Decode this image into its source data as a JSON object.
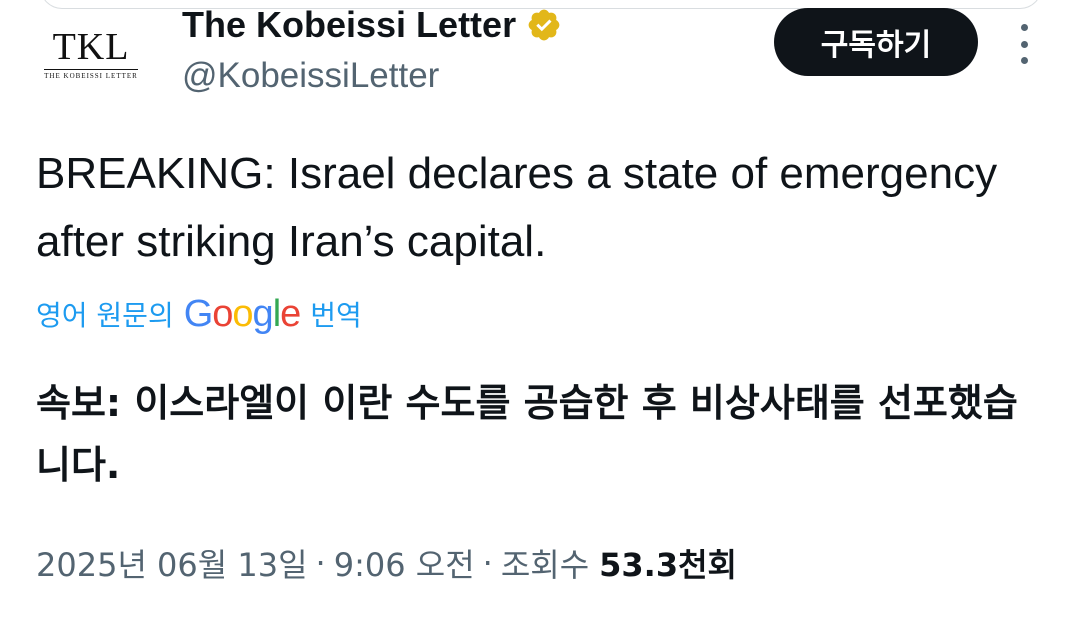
{
  "author": {
    "display_name": "The Kobeissi Letter",
    "handle": "@KobeissiLetter",
    "avatar_monogram": "TKL",
    "avatar_subtitle": "THE KOBEISSI LETTER",
    "verified_icon": "verified-badge-icon",
    "verified_color": "#e2b719"
  },
  "actions": {
    "subscribe_label": "구독하기",
    "more_icon": "more-vertical-icon"
  },
  "tweet": {
    "text": "BREAKING: Israel declares a state of emergency after striking Iran’s capital."
  },
  "translation": {
    "prefix": "영어 원문의",
    "google_letters": [
      "G",
      "o",
      "o",
      "g",
      "l",
      "e"
    ],
    "suffix": "번역",
    "text": "속보: 이스라엘이 이란 수도를 공습한 후 비상사태를 선포했습니다.",
    "link_color": "#1d9bf0"
  },
  "meta": {
    "date": "2025년 06월 13일",
    "time": "9:06 오전",
    "views_label": "조회수",
    "views_count": "53.3천회",
    "separator": "·"
  }
}
